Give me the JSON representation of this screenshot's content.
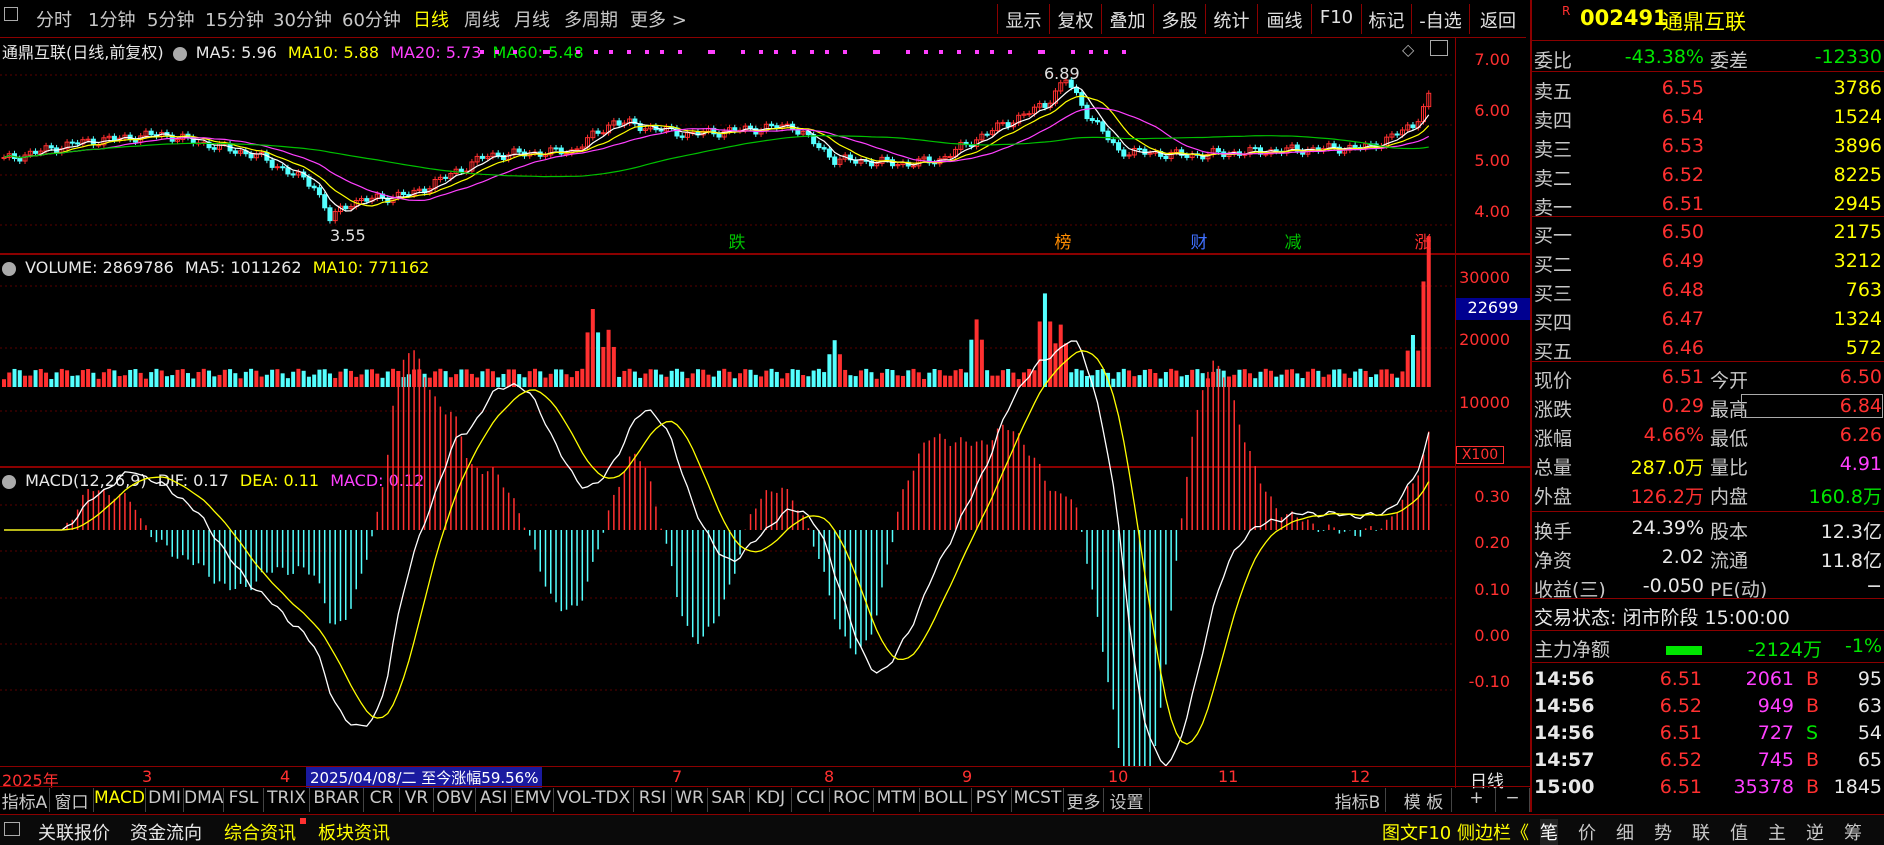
{
  "toolbar": {
    "period_tabs": [
      "分时",
      "1分钟",
      "5分钟",
      "15分钟",
      "30分钟",
      "60分钟",
      "日线",
      "周线",
      "月线",
      "多周期",
      "更多 >"
    ],
    "active_period": "日线",
    "right_buttons": [
      "显示",
      "复权",
      "叠加",
      "多股",
      "统计",
      "画线",
      "F10",
      "标记",
      "-自选",
      "返回"
    ]
  },
  "stock": {
    "badge": "R",
    "code": "002491",
    "name": "通鼎互联"
  },
  "kline_panel": {
    "title": "通鼎互联(日线,前复权)",
    "ma5": "MA5: 5.96",
    "ma10": "MA10: 5.88",
    "ma20": "MA20: 5.73",
    "ma60": "MA60: 5.48",
    "high_label": "6.89",
    "low_label": "3.55",
    "y_ticks": [
      "7.00",
      "6.00",
      "5.00",
      "4.00"
    ],
    "markers": [
      {
        "t": "跌",
        "c": "#00a000"
      },
      {
        "t": "榜",
        "c": "#ff8c00"
      },
      {
        "t": "财",
        "c": "#3060ff"
      },
      {
        "t": "减",
        "c": "#00a000"
      },
      {
        "t": "涨",
        "c": "#ff3030"
      }
    ]
  },
  "volume_panel": {
    "title": "VOLUME: 2869786",
    "ma5": "MA5: 1011262",
    "ma10": "MA10: 771162",
    "y_ticks": [
      "30000",
      "20000",
      "10000"
    ],
    "cursor_value": "22699",
    "unit": "X100"
  },
  "macd_panel": {
    "title": "MACD(12,26,9)",
    "dif": "DIF: 0.17",
    "dea": "DEA: 0.11",
    "macd": "MACD: 0.12",
    "y_ticks": [
      "0.30",
      "0.20",
      "0.10",
      "0.00",
      "-0.10"
    ]
  },
  "time_axis": {
    "year": "2025年",
    "months": [
      "3",
      "4",
      "7",
      "8",
      "9",
      "10",
      "11",
      "12"
    ],
    "info": "2025/04/08/二  至今涨幅59.56%",
    "period": "日线"
  },
  "indicator_tabs": [
    "指标A",
    "窗口",
    "MACD",
    "DMI",
    "DMA",
    "FSL",
    "TRIX",
    "BRAR",
    "CR",
    "VR",
    "OBV",
    "ASI",
    "EMV",
    "VOL-TDX",
    "RSI",
    "WR",
    "SAR",
    "KDJ",
    "CCI",
    "ROC",
    "MTM",
    "BOLL",
    "PSY",
    "MCST",
    "更多",
    "设置"
  ],
  "indicator_right": [
    "指标B",
    "模 板",
    "+",
    "−"
  ],
  "active_indicator": "MACD",
  "order_book": {
    "weibi_label": "委比",
    "weibi": "-43.38%",
    "weicha_label": "委差",
    "weicha": "-12330",
    "asks": [
      {
        "l": "卖五",
        "p": "6.55",
        "v": "3786"
      },
      {
        "l": "卖四",
        "p": "6.54",
        "v": "1524"
      },
      {
        "l": "卖三",
        "p": "6.53",
        "v": "3896"
      },
      {
        "l": "卖二",
        "p": "6.52",
        "v": "8225"
      },
      {
        "l": "卖一",
        "p": "6.51",
        "v": "2945"
      }
    ],
    "bids": [
      {
        "l": "买一",
        "p": "6.50",
        "v": "2175"
      },
      {
        "l": "买二",
        "p": "6.49",
        "v": "3212"
      },
      {
        "l": "买三",
        "p": "6.48",
        "v": "763"
      },
      {
        "l": "买四",
        "p": "6.47",
        "v": "1324"
      },
      {
        "l": "买五",
        "p": "6.46",
        "v": "572"
      }
    ]
  },
  "stats": [
    {
      "l1": "现价",
      "v1": "6.51",
      "c1": "red",
      "l2": "今开",
      "v2": "6.50",
      "c2": "red"
    },
    {
      "l1": "涨跌",
      "v1": "0.29",
      "c1": "red",
      "l2": "最高",
      "v2": "6.84",
      "c2": "red"
    },
    {
      "l1": "涨幅",
      "v1": "4.66%",
      "c1": "red",
      "l2": "最低",
      "v2": "6.26",
      "c2": "red"
    },
    {
      "l1": "总量",
      "v1": "287.0万",
      "c1": "yel",
      "l2": "量比",
      "v2": "4.91",
      "c2": "mag"
    },
    {
      "l1": "外盘",
      "v1": "126.2万",
      "c1": "red",
      "l2": "内盘",
      "v2": "160.8万",
      "c2": "green"
    },
    {
      "l1": "换手",
      "v1": "24.39%",
      "c1": "wht",
      "l2": "股本",
      "v2": "12.3亿",
      "c2": "wht"
    },
    {
      "l1": "净资",
      "v1": "2.02",
      "c1": "wht",
      "l2": "流通",
      "v2": "11.8亿",
      "c2": "wht"
    },
    {
      "l1": "收益(三)",
      "v1": "-0.050",
      "c1": "wht",
      "l2": "PE(动)",
      "v2": "−",
      "c2": "wht"
    }
  ],
  "trade_status": "交易状态: 闭市阶段 15:00:00",
  "main_flow": {
    "label": "主力净额",
    "value": "-2124万",
    "pct": "-1%"
  },
  "ticks": [
    {
      "t": "14:56",
      "p": "6.51",
      "v": "2061",
      "s": "B",
      "n": "95"
    },
    {
      "t": "14:56",
      "p": "6.52",
      "v": "949",
      "s": "B",
      "n": "63"
    },
    {
      "t": "14:56",
      "p": "6.51",
      "v": "727",
      "s": "S",
      "n": "54"
    },
    {
      "t": "14:57",
      "p": "6.52",
      "v": "745",
      "s": "B",
      "n": "65"
    },
    {
      "t": "15:00",
      "p": "6.51",
      "v": "35378",
      "s": "B",
      "n": "1845"
    }
  ],
  "statusbar": {
    "left": [
      "关联报价",
      "资金流向",
      "综合资讯",
      "板块资讯"
    ],
    "right": "图文F10 侧边栏《",
    "tabs": [
      "笔",
      "价",
      "细",
      "势",
      "联",
      "值",
      "主",
      "逆",
      "筹"
    ]
  },
  "colors": {
    "up": "#ff3030",
    "down": "#54ffff",
    "ma5": "#ffffff",
    "ma10": "#ffff00",
    "ma20": "#ff40ff",
    "ma60": "#00c000"
  }
}
